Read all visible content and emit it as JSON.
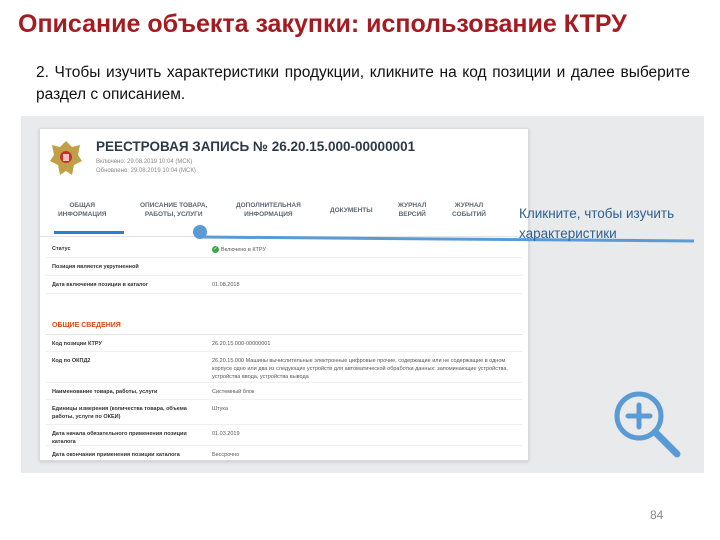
{
  "slide": {
    "title": "Описание объекта закупки: использование КТРУ",
    "instruction": "2. Чтобы изучить характеристики продукции, кликните на код позиции и далее выберите раздел с описанием.",
    "page_number": "84"
  },
  "colors": {
    "title": "#a41b22",
    "accent": "#2b7fd1",
    "callout": "#2f5f8f",
    "section": "#d84a1b"
  },
  "record": {
    "title": "РЕЕСТРОВАЯ ЗАПИСЬ № 26.20.15.000-00000001",
    "included": "Включено: 29.08.2019 10:04 (МСК)",
    "updated": "Обновлено: 29.08.2019 10:04 (МСК)"
  },
  "tabs": [
    {
      "label": "ОБЩАЯ\nИНФОРМАЦИЯ"
    },
    {
      "label": "ОПИСАНИЕ ТОВАРА,\nРАБОТЫ, УСЛУГИ"
    },
    {
      "label": "ДОПОЛНИТЕЛЬНАЯ\nИНФОРМАЦИЯ"
    },
    {
      "label": "ДОКУМЕНТЫ"
    },
    {
      "label": "ЖУРНАЛ\nВЕРСИЙ"
    },
    {
      "label": "ЖУРНАЛ\nСОБЫТИЙ"
    }
  ],
  "status_rows": [
    {
      "label": "Статус",
      "value": "Включено в КТРУ"
    },
    {
      "label": "Позиция является укрупненной",
      "value": ""
    },
    {
      "label": "Дата включения позиции в каталог",
      "value": "01.08.2018"
    }
  ],
  "general": {
    "heading": "ОБЩИЕ СВЕДЕНИЯ",
    "rows": [
      {
        "label": "Код позиции КТРУ",
        "value": "26.20.15.000-00000001"
      },
      {
        "label": "Код по ОКПД2",
        "value": "26.20.15.000 Машины вычислительные электронные цифровые прочие, содержащие или не содержащие в одном корпусе одно или два из следующих устройств для автоматической обработки данных: запоминающие устройства, устройства ввода, устройства вывода"
      },
      {
        "label": "Наименование товара, работы, услуги",
        "value": "Системный блок"
      },
      {
        "label": "Единицы измерения (количества товара, объема работы, услуги по ОКЕИ)",
        "value": "Штука"
      },
      {
        "label": "Дата начала обязательного применения позиции каталога",
        "value": "01.03.2019"
      },
      {
        "label": "Дата окончания применения позиции каталога",
        "value": "Бессрочно"
      }
    ]
  },
  "callout": {
    "text": "Кликните, чтобы изучить характеристики"
  },
  "icons": {
    "emblem": "coat-of-arms-icon",
    "magnifier": "zoom-in-icon",
    "check": "check-circle-icon"
  }
}
